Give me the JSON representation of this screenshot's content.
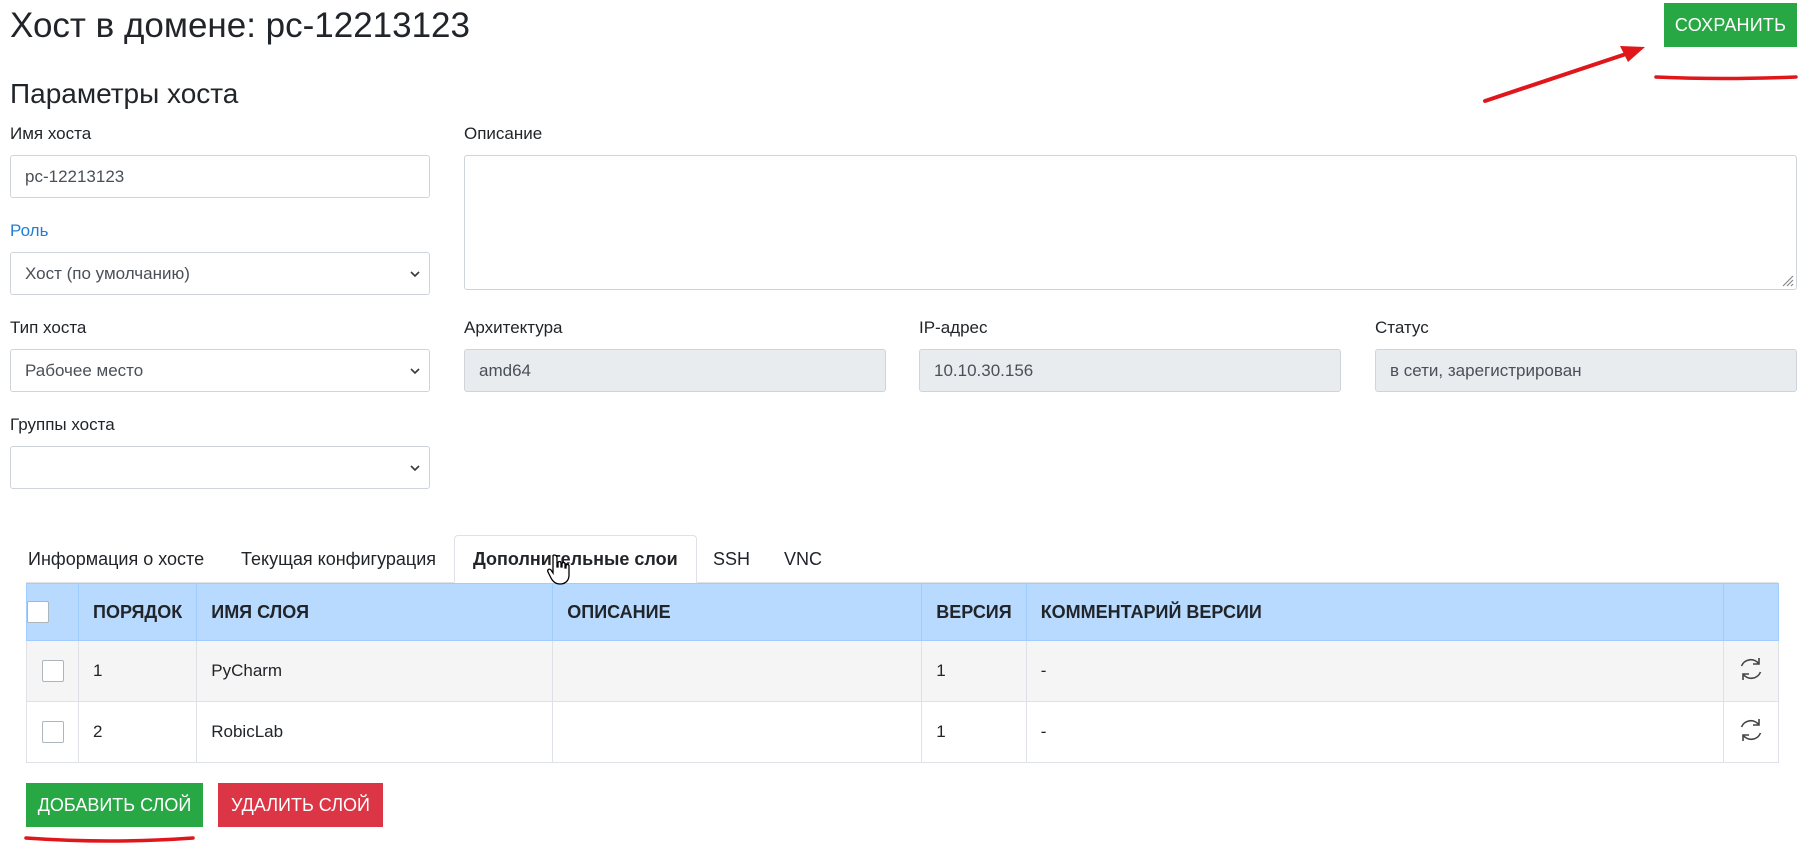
{
  "header": {
    "title": "Хост в домене: pc-12213123",
    "save_label": "СОХРАНИТЬ"
  },
  "params": {
    "section_title": "Параметры хоста",
    "host_name_label": "Имя хоста",
    "host_name_value": "pc-12213123",
    "description_label": "Описание",
    "description_value": "",
    "role_label": "Роль",
    "role_value": "Хост (по умолчанию)",
    "host_type_label": "Тип хоста",
    "host_type_value": "Рабочее место",
    "arch_label": "Архитектура",
    "arch_value": "amd64",
    "ip_label": "IP-адрес",
    "ip_value": "10.10.30.156",
    "status_label": "Статус",
    "status_value": "в сети, зарегистрирован",
    "groups_label": "Группы хоста",
    "groups_value": ""
  },
  "tabs": [
    {
      "label": "Информация о хосте",
      "active": false
    },
    {
      "label": "Текущая конфигурация",
      "active": false
    },
    {
      "label": "Дополнительные слои",
      "active": true
    },
    {
      "label": "SSH",
      "active": false
    },
    {
      "label": "VNC",
      "active": false
    }
  ],
  "layers_table": {
    "columns": [
      "ПОРЯДОК",
      "ИМЯ СЛОЯ",
      "ОПИСАНИЕ",
      "ВЕРСИЯ",
      "КОММЕНТАРИЙ ВЕРСИИ"
    ],
    "rows": [
      {
        "order": "1",
        "name": "PyCharm",
        "description": "",
        "version": "1",
        "comment": "-"
      },
      {
        "order": "2",
        "name": "RobicLab",
        "description": "",
        "version": "1",
        "comment": "-"
      }
    ]
  },
  "actions": {
    "add_label": "ДОБАВИТЬ СЛОЙ",
    "delete_label": "УДАЛИТЬ СЛОЙ"
  },
  "colors": {
    "success": "#28a745",
    "danger": "#dc3545",
    "table_header": "#b8daff",
    "link": "#1f7fd6",
    "annotation": "#e0161b"
  },
  "icons": [
    "chevron-down-icon",
    "refresh-icon",
    "resize-grip-icon",
    "hand-cursor-icon",
    "annotation-arrow"
  ]
}
